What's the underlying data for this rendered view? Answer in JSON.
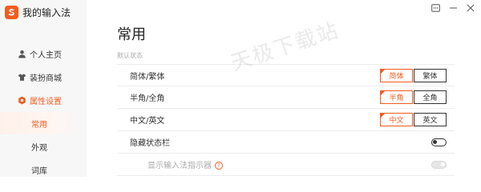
{
  "app": {
    "title": "我的输入法",
    "logo_icon": "sogou-s-logo",
    "accent_color": "#f25c1f"
  },
  "window": {
    "controls": [
      "menu-icon",
      "minimize-icon",
      "close-icon"
    ]
  },
  "sidebar": {
    "items": [
      {
        "label": "个人主页",
        "icon": "person-icon"
      },
      {
        "label": "装扮商城",
        "icon": "shirt-icon"
      },
      {
        "label": "属性设置",
        "icon": "gear-icon"
      }
    ],
    "subitems": [
      {
        "label": "常用"
      },
      {
        "label": "外观"
      },
      {
        "label": "词库"
      }
    ]
  },
  "main": {
    "title": "常用",
    "section": "默认状态",
    "rows": [
      {
        "label": "简体/繁体",
        "options": [
          "简体",
          "繁体"
        ],
        "selected": 0
      },
      {
        "label": "半角/全角",
        "options": [
          "半角",
          "全角"
        ],
        "selected": 0
      },
      {
        "label": "中文/英文",
        "options": [
          "中文",
          "英文"
        ],
        "selected": 0
      },
      {
        "label": "隐藏状态栏",
        "toggle": false
      },
      {
        "label": "显示输入法指示器",
        "help": "?",
        "toggle": true,
        "disabled": true
      }
    ]
  },
  "watermark": "天极下载站"
}
